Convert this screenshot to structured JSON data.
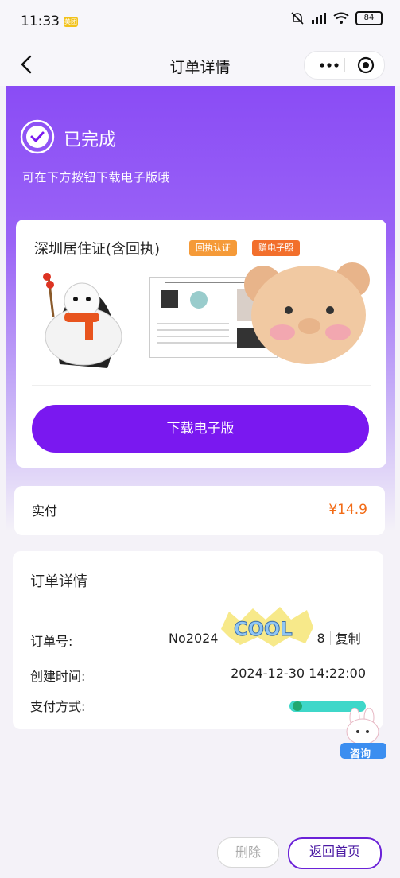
{
  "status_bar": {
    "time": "11:33",
    "badge": "美团",
    "battery": "84"
  },
  "nav": {
    "title": "订单详情"
  },
  "hero": {
    "status_title": "已完成",
    "status_subtitle": "可在下方按钮下载电子版哦"
  },
  "product": {
    "title": "深圳居住证(含回执)",
    "tags": [
      "回执认证",
      "赠电子照"
    ],
    "download_label": "下载电子版"
  },
  "payment": {
    "label": "实付",
    "amount": "¥14.9"
  },
  "order_detail": {
    "title": "订单详情",
    "order_no_label": "订单号:",
    "order_no_value": "No2024",
    "order_no_tail": "8",
    "copy_label": "复制",
    "created_label": "创建时间:",
    "created_value": "2024-12-30 14:22:00",
    "pay_method_label": "支付方式:"
  },
  "consult": {
    "label": "咨询"
  },
  "bottom": {
    "delete_label": "删除",
    "home_label": "返回首页"
  },
  "colors": {
    "accent": "#7a18f0",
    "price": "#f26b16",
    "tag_orange": "#f59a38"
  }
}
